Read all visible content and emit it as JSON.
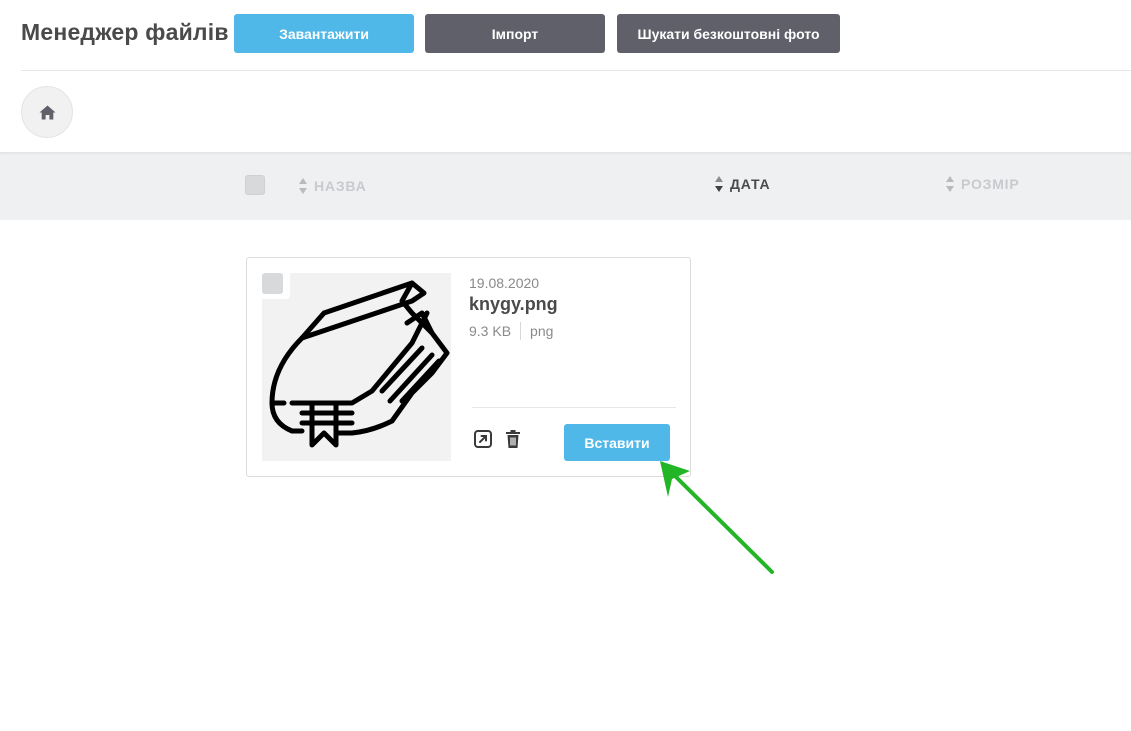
{
  "header": {
    "title": "Менеджер файлів",
    "buttons": {
      "upload": "Завантажити",
      "import": "Імпорт",
      "free_photos": "Шукати безкоштовні фото"
    }
  },
  "breadcrumb": {
    "home_icon": "home-icon"
  },
  "columns": {
    "name": "НАЗВА",
    "date": "ДАТА",
    "size": "РОЗМІР",
    "active_sort": "date"
  },
  "files": [
    {
      "date": "19.08.2020",
      "name": "knygy.png",
      "size": "9.3 KB",
      "type": "png",
      "thumbnail_icon": "book-icon",
      "insert_label": "Вставити"
    }
  ],
  "colors": {
    "primary": "#4fb8e9",
    "secondary": "#5f6069",
    "header_bg": "#eff0f2",
    "annotation_arrow": "#22b526"
  }
}
